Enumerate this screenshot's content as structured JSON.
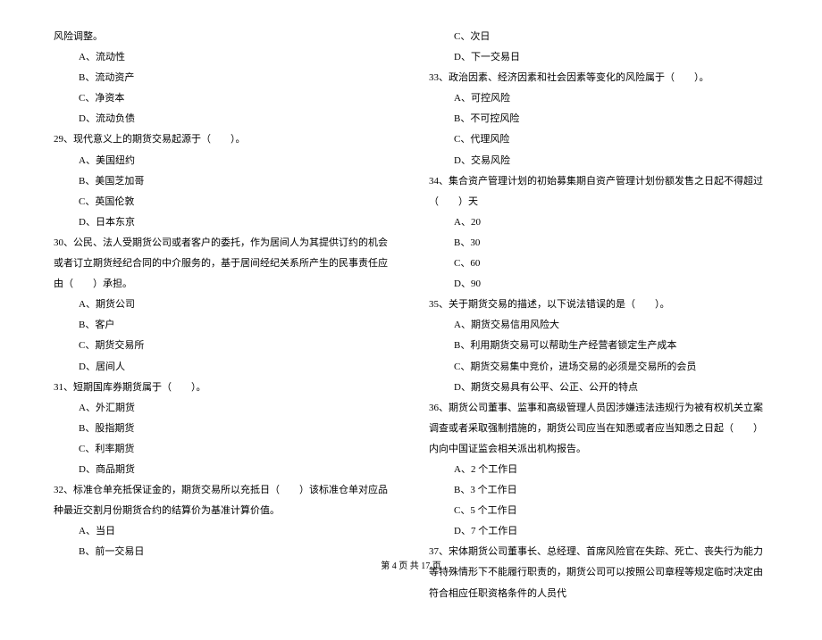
{
  "left": {
    "intro": "风险调整。",
    "introOptions": [
      "A、流动性",
      "B、流动资产",
      "C、净资本",
      "D、流动负债"
    ],
    "q29": "29、现代意义上的期货交易起源于（　　）。",
    "q29Options": [
      "A、美国纽约",
      "B、美国芝加哥",
      "C、英国伦敦",
      "D、日本东京"
    ],
    "q30": "30、公民、法人受期货公司或者客户的委托，作为居间人为其提供订约的机会或者订立期货经纪合同的中介服务的，基于居间经纪关系所产生的民事责任应由（　　）承担。",
    "q30Options": [
      "A、期货公司",
      "B、客户",
      "C、期货交易所",
      "D、居间人"
    ],
    "q31": "31、短期国库券期货属于（　　）。",
    "q31Options": [
      "A、外汇期货",
      "B、股指期货",
      "C、利率期货",
      "D、商品期货"
    ],
    "q32": "32、标准仓单充抵保证金的，期货交易所以充抵日（　　）该标准仓单对应品种最近交割月份期货合约的结算价为基准计算价值。",
    "q32Options": [
      "A、当日",
      "B、前一交易日"
    ]
  },
  "right": {
    "q32OptionsCont": [
      "C、次日",
      "D、下一交易日"
    ],
    "q33": "33、政治因素、经济因素和社会因素等变化的风险属于（　　）。",
    "q33Options": [
      "A、可控风险",
      "B、不可控风险",
      "C、代理风险",
      "D、交易风险"
    ],
    "q34": "34、集合资产管理计划的初始募集期自资产管理计划份额发售之日起不得超过（　　）天",
    "q34Options": [
      "A、20",
      "B、30",
      "C、60",
      "D、90"
    ],
    "q35": "35、关于期货交易的描述，以下说法错误的是（　　）。",
    "q35Options": [
      "A、期货交易信用风险大",
      "B、利用期货交易可以帮助生产经营者锁定生产成本",
      "C、期货交易集中竞价，进场交易的必须是交易所的会员",
      "D、期货交易具有公平、公正、公开的特点"
    ],
    "q36": "36、期货公司董事、监事和高级管理人员因涉嫌违法违规行为被有权机关立案调查或者采取强制措施的，期货公司应当在知悉或者应当知悉之日起（　　）内向中国证监会相关派出机构报告。",
    "q36Options": [
      "A、2 个工作日",
      "B、3 个工作日",
      "C、5 个工作日",
      "D、7 个工作日"
    ],
    "q37": "37、宋体期货公司董事长、总经理、首席风险官在失踪、死亡、丧失行为能力等特殊情形下不能履行职责的，期货公司可以按照公司章程等规定临时决定由符合相应任职资格条件的人员代"
  },
  "footer": "第 4 页 共 17 页"
}
